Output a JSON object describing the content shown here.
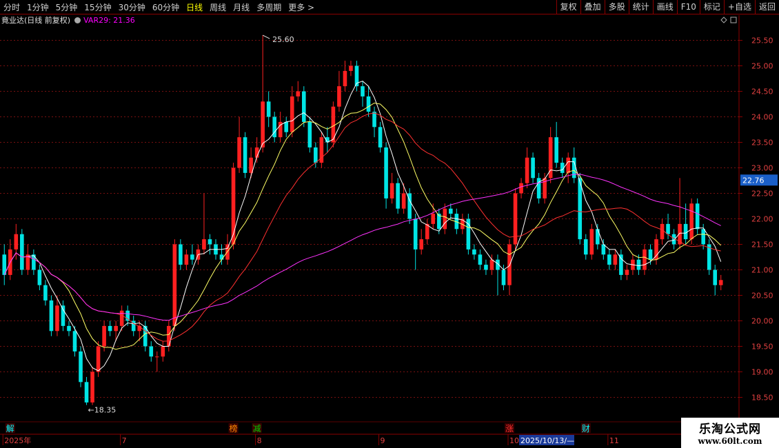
{
  "toolbar": {
    "timeframes": [
      "分时",
      "1分钟",
      "5分钟",
      "15分钟",
      "30分钟",
      "60分钟",
      "日线",
      "周线",
      "月线",
      "多周期",
      "更多 >"
    ],
    "active": "日线",
    "right_buttons": [
      "复权",
      "叠加",
      "多股",
      "统计",
      "画线",
      "F10",
      "标记",
      "+自选",
      "返回"
    ]
  },
  "info": {
    "stock": "竟业达(日线 前复权)",
    "var_text": "VAR29: 21.36"
  },
  "price_tag": "22.76",
  "annotations": {
    "high": "25.60",
    "low": "←18.35"
  },
  "events": [
    {
      "label": "解",
      "color": "#00ffff",
      "idx": 1
    },
    {
      "label": "榜",
      "color": "#ff8c00",
      "idx": 39
    },
    {
      "label": "减",
      "color": "#00cc00",
      "idx": 43
    },
    {
      "label": "涨",
      "color": "#ff3030",
      "idx": 86
    },
    {
      "label": "财",
      "color": "#00ffff",
      "idx": 99
    }
  ],
  "date_labels": [
    {
      "text": "2025年",
      "idx": 0
    },
    {
      "text": "7",
      "idx": 20
    },
    {
      "text": "8",
      "idx": 43
    },
    {
      "text": "9",
      "idx": 64
    },
    {
      "text": "10",
      "idx": 86
    },
    {
      "text": "11",
      "idx": 103
    }
  ],
  "date_highlight": "2025/10/13/—",
  "logo": {
    "cn": "乐淘公式网",
    "url": "www.60lt.com"
  },
  "chart_data": {
    "type": "candlestick",
    "ylim": [
      18.25,
      25.75
    ],
    "y_ticks": [
      18.5,
      19.0,
      19.5,
      20.0,
      20.5,
      21.0,
      21.5,
      22.0,
      22.5,
      23.0,
      23.5,
      24.0,
      24.5,
      25.0,
      25.5
    ],
    "up_color": "#ff2020",
    "down_color": "#00e5e5",
    "ma_colors": [
      "#ffffff",
      "#ffff66",
      "#ff3030",
      "#ff33ff"
    ],
    "candles": [
      [
        21.3,
        20.9,
        21.5,
        20.7
      ],
      [
        20.9,
        21.4,
        21.6,
        20.8
      ],
      [
        21.4,
        21.7,
        21.9,
        21.2
      ],
      [
        21.7,
        21.0,
        21.8,
        20.9
      ],
      [
        21.0,
        21.3,
        21.5,
        20.9
      ],
      [
        21.3,
        21.0,
        21.4,
        20.9
      ],
      [
        21.0,
        20.7,
        21.1,
        20.6
      ],
      [
        20.7,
        20.4,
        20.8,
        20.3
      ],
      [
        20.4,
        19.8,
        20.5,
        19.7
      ],
      [
        19.8,
        20.3,
        20.5,
        19.7
      ],
      [
        20.3,
        19.9,
        20.4,
        19.8
      ],
      [
        19.9,
        19.8,
        20.0,
        19.7
      ],
      [
        19.8,
        19.4,
        19.9,
        19.3
      ],
      [
        19.4,
        18.8,
        19.5,
        18.7
      ],
      [
        18.8,
        18.4,
        18.9,
        18.35
      ],
      [
        18.4,
        19.0,
        19.1,
        18.35
      ],
      [
        19.0,
        19.5,
        19.6,
        18.9
      ],
      [
        19.5,
        19.9,
        20.0,
        19.4
      ],
      [
        19.9,
        19.8,
        20.0,
        19.7
      ],
      [
        19.8,
        19.9,
        20.0,
        19.6
      ],
      [
        19.9,
        20.2,
        20.3,
        19.8
      ],
      [
        20.2,
        20.0,
        20.3,
        19.9
      ],
      [
        20.0,
        19.8,
        20.1,
        19.7
      ],
      [
        19.8,
        19.9,
        20.0,
        19.6
      ],
      [
        19.9,
        19.5,
        20.0,
        19.4
      ],
      [
        19.5,
        19.3,
        19.6,
        19.2
      ],
      [
        19.3,
        19.3,
        19.4,
        19.0
      ],
      [
        19.3,
        19.5,
        19.6,
        19.2
      ],
      [
        19.5,
        19.9,
        20.0,
        19.4
      ],
      [
        19.9,
        21.5,
        21.6,
        19.8
      ],
      [
        21.5,
        21.1,
        21.6,
        21.0
      ],
      [
        21.1,
        21.3,
        21.4,
        21.0
      ],
      [
        21.3,
        21.2,
        21.5,
        21.1
      ],
      [
        21.2,
        21.4,
        21.5,
        21.1
      ],
      [
        21.4,
        21.6,
        22.5,
        21.3
      ],
      [
        21.6,
        21.5,
        21.7,
        21.3
      ],
      [
        21.5,
        21.3,
        21.6,
        21.2
      ],
      [
        21.3,
        21.2,
        21.5,
        21.1
      ],
      [
        21.2,
        21.5,
        21.7,
        21.1
      ],
      [
        21.5,
        23.0,
        23.1,
        21.4
      ],
      [
        23.0,
        23.6,
        24.0,
        22.9
      ],
      [
        23.6,
        22.9,
        23.7,
        22.8
      ],
      [
        22.9,
        23.2,
        23.4,
        22.8
      ],
      [
        23.2,
        23.4,
        23.6,
        23.1
      ],
      [
        23.4,
        24.3,
        25.6,
        23.3
      ],
      [
        24.3,
        24.0,
        24.5,
        23.8
      ],
      [
        24.0,
        23.6,
        24.1,
        23.5
      ],
      [
        23.6,
        23.9,
        24.1,
        23.5
      ],
      [
        23.9,
        23.7,
        24.0,
        23.6
      ],
      [
        23.7,
        24.4,
        24.6,
        23.6
      ],
      [
        24.4,
        24.5,
        24.7,
        24.3
      ],
      [
        24.5,
        23.9,
        24.6,
        23.8
      ],
      [
        23.9,
        23.4,
        24.0,
        23.3
      ],
      [
        23.4,
        23.1,
        23.5,
        23.0
      ],
      [
        23.1,
        23.6,
        23.7,
        23.0
      ],
      [
        23.6,
        23.5,
        23.8,
        23.3
      ],
      [
        23.5,
        24.2,
        24.3,
        23.4
      ],
      [
        24.2,
        24.6,
        24.9,
        24.1
      ],
      [
        24.6,
        24.9,
        25.1,
        24.5
      ],
      [
        24.9,
        25.0,
        25.1,
        24.8
      ],
      [
        25.0,
        24.6,
        25.1,
        24.5
      ],
      [
        24.6,
        24.4,
        24.7,
        24.2
      ],
      [
        24.4,
        24.1,
        24.6,
        24.0
      ],
      [
        24.1,
        23.8,
        24.2,
        23.6
      ],
      [
        23.8,
        23.4,
        23.9,
        23.3
      ],
      [
        23.4,
        22.4,
        23.5,
        22.2
      ],
      [
        22.4,
        22.7,
        22.9,
        22.3
      ],
      [
        22.7,
        22.2,
        22.8,
        22.1
      ],
      [
        22.2,
        22.5,
        22.7,
        22.1
      ],
      [
        22.5,
        22.0,
        22.6,
        21.9
      ],
      [
        22.0,
        21.4,
        22.1,
        21.0
      ],
      [
        21.4,
        21.6,
        21.8,
        21.3
      ],
      [
        21.6,
        21.9,
        22.0,
        21.5
      ],
      [
        21.9,
        22.1,
        22.3,
        21.8
      ],
      [
        22.1,
        21.8,
        22.2,
        21.7
      ],
      [
        21.8,
        22.2,
        22.3,
        21.7
      ],
      [
        22.2,
        22.1,
        22.3,
        22.0
      ],
      [
        22.1,
        21.8,
        22.2,
        21.7
      ],
      [
        21.8,
        22.0,
        22.1,
        21.7
      ],
      [
        22.0,
        21.4,
        22.1,
        21.3
      ],
      [
        21.4,
        21.3,
        21.5,
        21.2
      ],
      [
        21.3,
        21.1,
        21.4,
        21.0
      ],
      [
        21.1,
        21.0,
        21.2,
        20.9
      ],
      [
        21.0,
        21.2,
        21.3,
        20.9
      ],
      [
        21.2,
        21.0,
        21.3,
        20.5
      ],
      [
        21.0,
        20.7,
        21.1,
        20.6
      ],
      [
        20.7,
        21.5,
        21.6,
        20.5
      ],
      [
        21.5,
        22.5,
        22.6,
        21.4
      ],
      [
        22.5,
        22.7,
        22.8,
        22.4
      ],
      [
        22.7,
        23.2,
        23.4,
        22.6
      ],
      [
        23.2,
        22.8,
        23.3,
        22.7
      ],
      [
        22.8,
        22.4,
        22.9,
        22.3
      ],
      [
        22.4,
        22.8,
        22.9,
        22.3
      ],
      [
        22.8,
        23.6,
        23.8,
        22.7
      ],
      [
        23.6,
        23.1,
        23.9,
        23.0
      ],
      [
        23.1,
        22.9,
        23.2,
        22.8
      ],
      [
        22.9,
        23.2,
        23.3,
        22.7
      ],
      [
        23.2,
        22.8,
        23.4,
        22.7
      ],
      [
        22.8,
        21.6,
        22.9,
        21.5
      ],
      [
        21.6,
        21.3,
        21.7,
        21.2
      ],
      [
        21.3,
        21.8,
        21.9,
        21.2
      ],
      [
        21.8,
        21.5,
        21.9,
        21.4
      ],
      [
        21.5,
        21.3,
        21.6,
        21.2
      ],
      [
        21.3,
        21.1,
        21.4,
        21.0
      ],
      [
        21.1,
        21.3,
        21.4,
        21.0
      ],
      [
        21.3,
        20.9,
        21.4,
        20.8
      ],
      [
        20.9,
        21.0,
        21.1,
        20.8
      ],
      [
        21.0,
        21.2,
        21.3,
        20.9
      ],
      [
        21.2,
        21.0,
        21.3,
        20.9
      ],
      [
        21.0,
        21.4,
        21.5,
        20.9
      ],
      [
        21.4,
        21.2,
        21.5,
        21.1
      ],
      [
        21.2,
        21.6,
        21.7,
        21.1
      ],
      [
        21.6,
        21.9,
        22.0,
        21.5
      ],
      [
        21.9,
        21.7,
        22.1,
        21.6
      ],
      [
        21.7,
        21.5,
        21.8,
        21.4
      ],
      [
        21.5,
        21.9,
        22.8,
        21.4
      ],
      [
        21.9,
        21.6,
        22.3,
        21.5
      ],
      [
        21.6,
        22.3,
        22.4,
        21.5
      ],
      [
        22.3,
        21.8,
        22.4,
        21.7
      ],
      [
        21.8,
        21.5,
        21.9,
        21.4
      ],
      [
        21.5,
        21.0,
        21.6,
        20.9
      ],
      [
        21.0,
        20.7,
        21.1,
        20.5
      ],
      [
        20.7,
        20.8,
        20.9,
        20.6
      ]
    ],
    "ma_periods": [
      5,
      10,
      20,
      60
    ]
  }
}
